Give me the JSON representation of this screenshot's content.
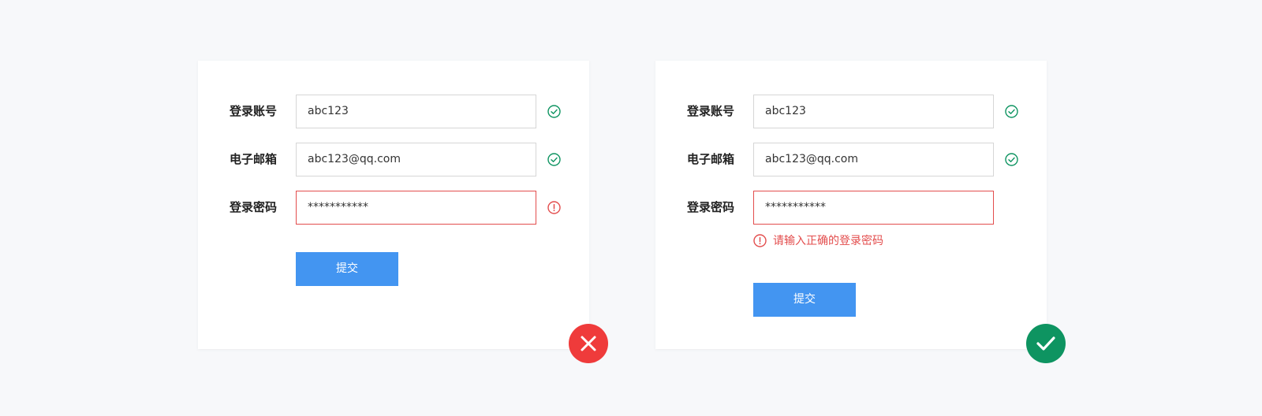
{
  "colors": {
    "success": "#0e9461",
    "error": "#e34d4d",
    "primary": "#4395f1",
    "wrong_badge": "#ef3b3b"
  },
  "bad_example": {
    "account_label": "登录账号",
    "account_value": "abc123",
    "email_label": "电子邮箱",
    "email_value": "abc123@qq.com",
    "password_label": "登录密码",
    "password_value": "***********",
    "submit_label": "提交"
  },
  "good_example": {
    "account_label": "登录账号",
    "account_value": "abc123",
    "email_label": "电子邮箱",
    "email_value": "abc123@qq.com",
    "password_label": "登录密码",
    "password_value": "***********",
    "error_message": "请输入正确的登录密码",
    "submit_label": "提交"
  },
  "icons": {
    "valid": "check-circle-icon",
    "invalid": "alert-circle-icon",
    "wrong_badge": "cross-icon",
    "right_badge": "check-icon"
  }
}
